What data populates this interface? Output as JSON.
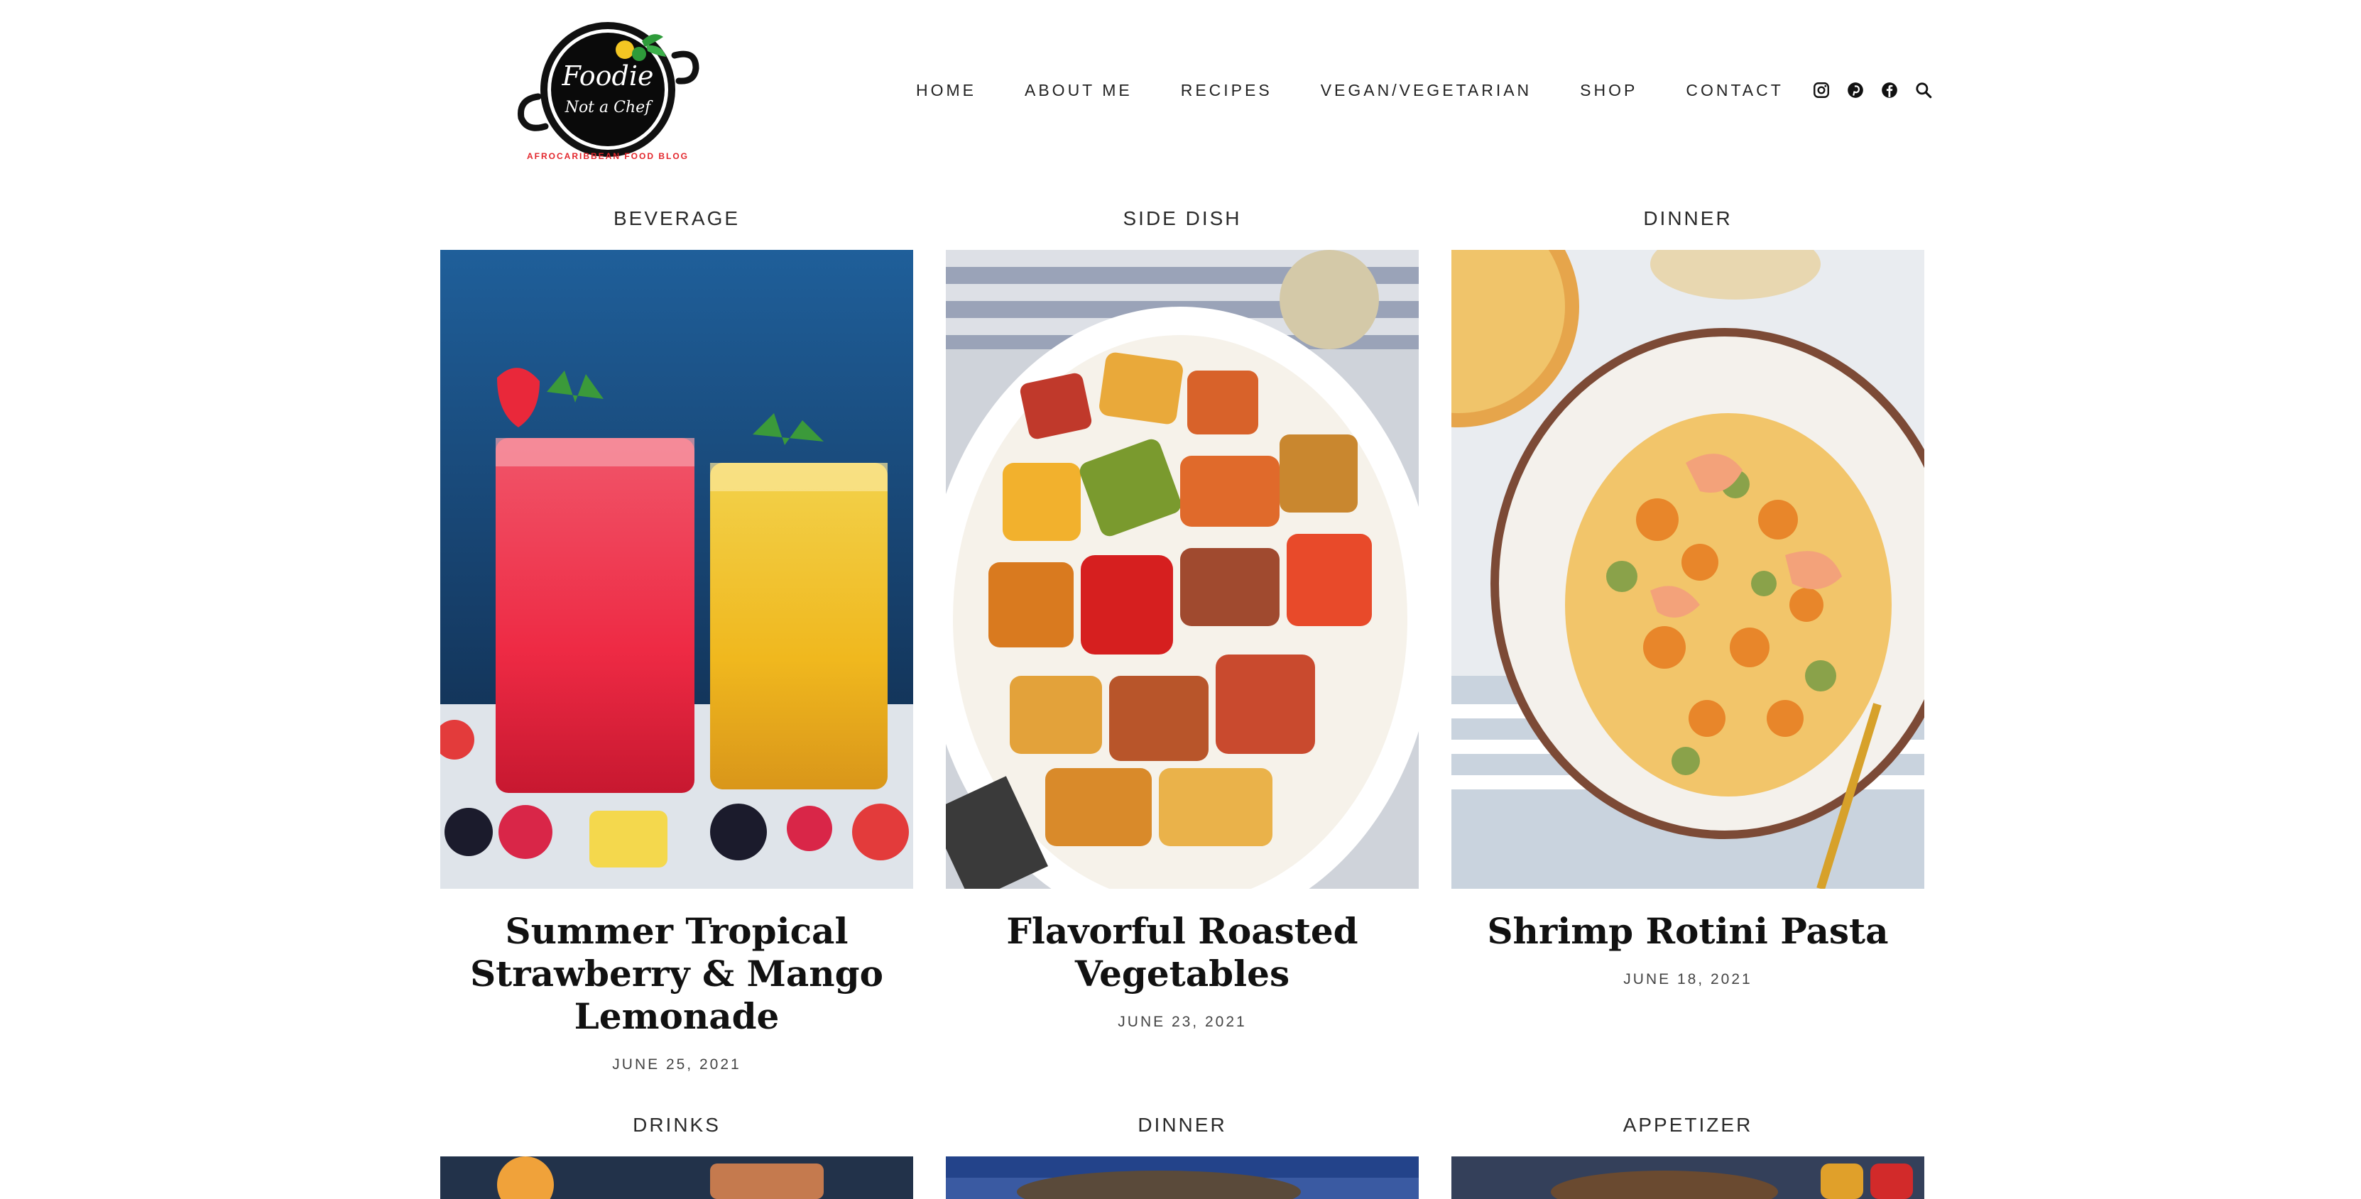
{
  "logo": {
    "line1": "Foodie",
    "line2": "Not a Chef",
    "tagline": "AFROCARIBBEAN FOOD BLOG"
  },
  "nav": {
    "items": [
      "HOME",
      "ABOUT ME",
      "RECIPES",
      "VEGAN/VEGETARIAN",
      "SHOP",
      "CONTACT"
    ]
  },
  "social": {
    "icons": [
      "instagram-icon",
      "pinterest-icon",
      "facebook-icon",
      "search-icon"
    ]
  },
  "posts": [
    {
      "category": "BEVERAGE",
      "title": "Summer Tropical Strawberry & Mango Lemonade",
      "date": "JUNE 25, 2021"
    },
    {
      "category": "SIDE DISH",
      "title": "Flavorful Roasted Vegetables",
      "date": "JUNE 23, 2021"
    },
    {
      "category": "DINNER",
      "title": "Shrimp Rotini Pasta",
      "date": "JUNE 18, 2021"
    },
    {
      "category": "DRINKS"
    },
    {
      "category": "DINNER"
    },
    {
      "category": "APPETIZER"
    }
  ],
  "colors": {
    "text": "#111111",
    "logo_red": "#e3262c",
    "logo_green": "#2e9b3a"
  }
}
